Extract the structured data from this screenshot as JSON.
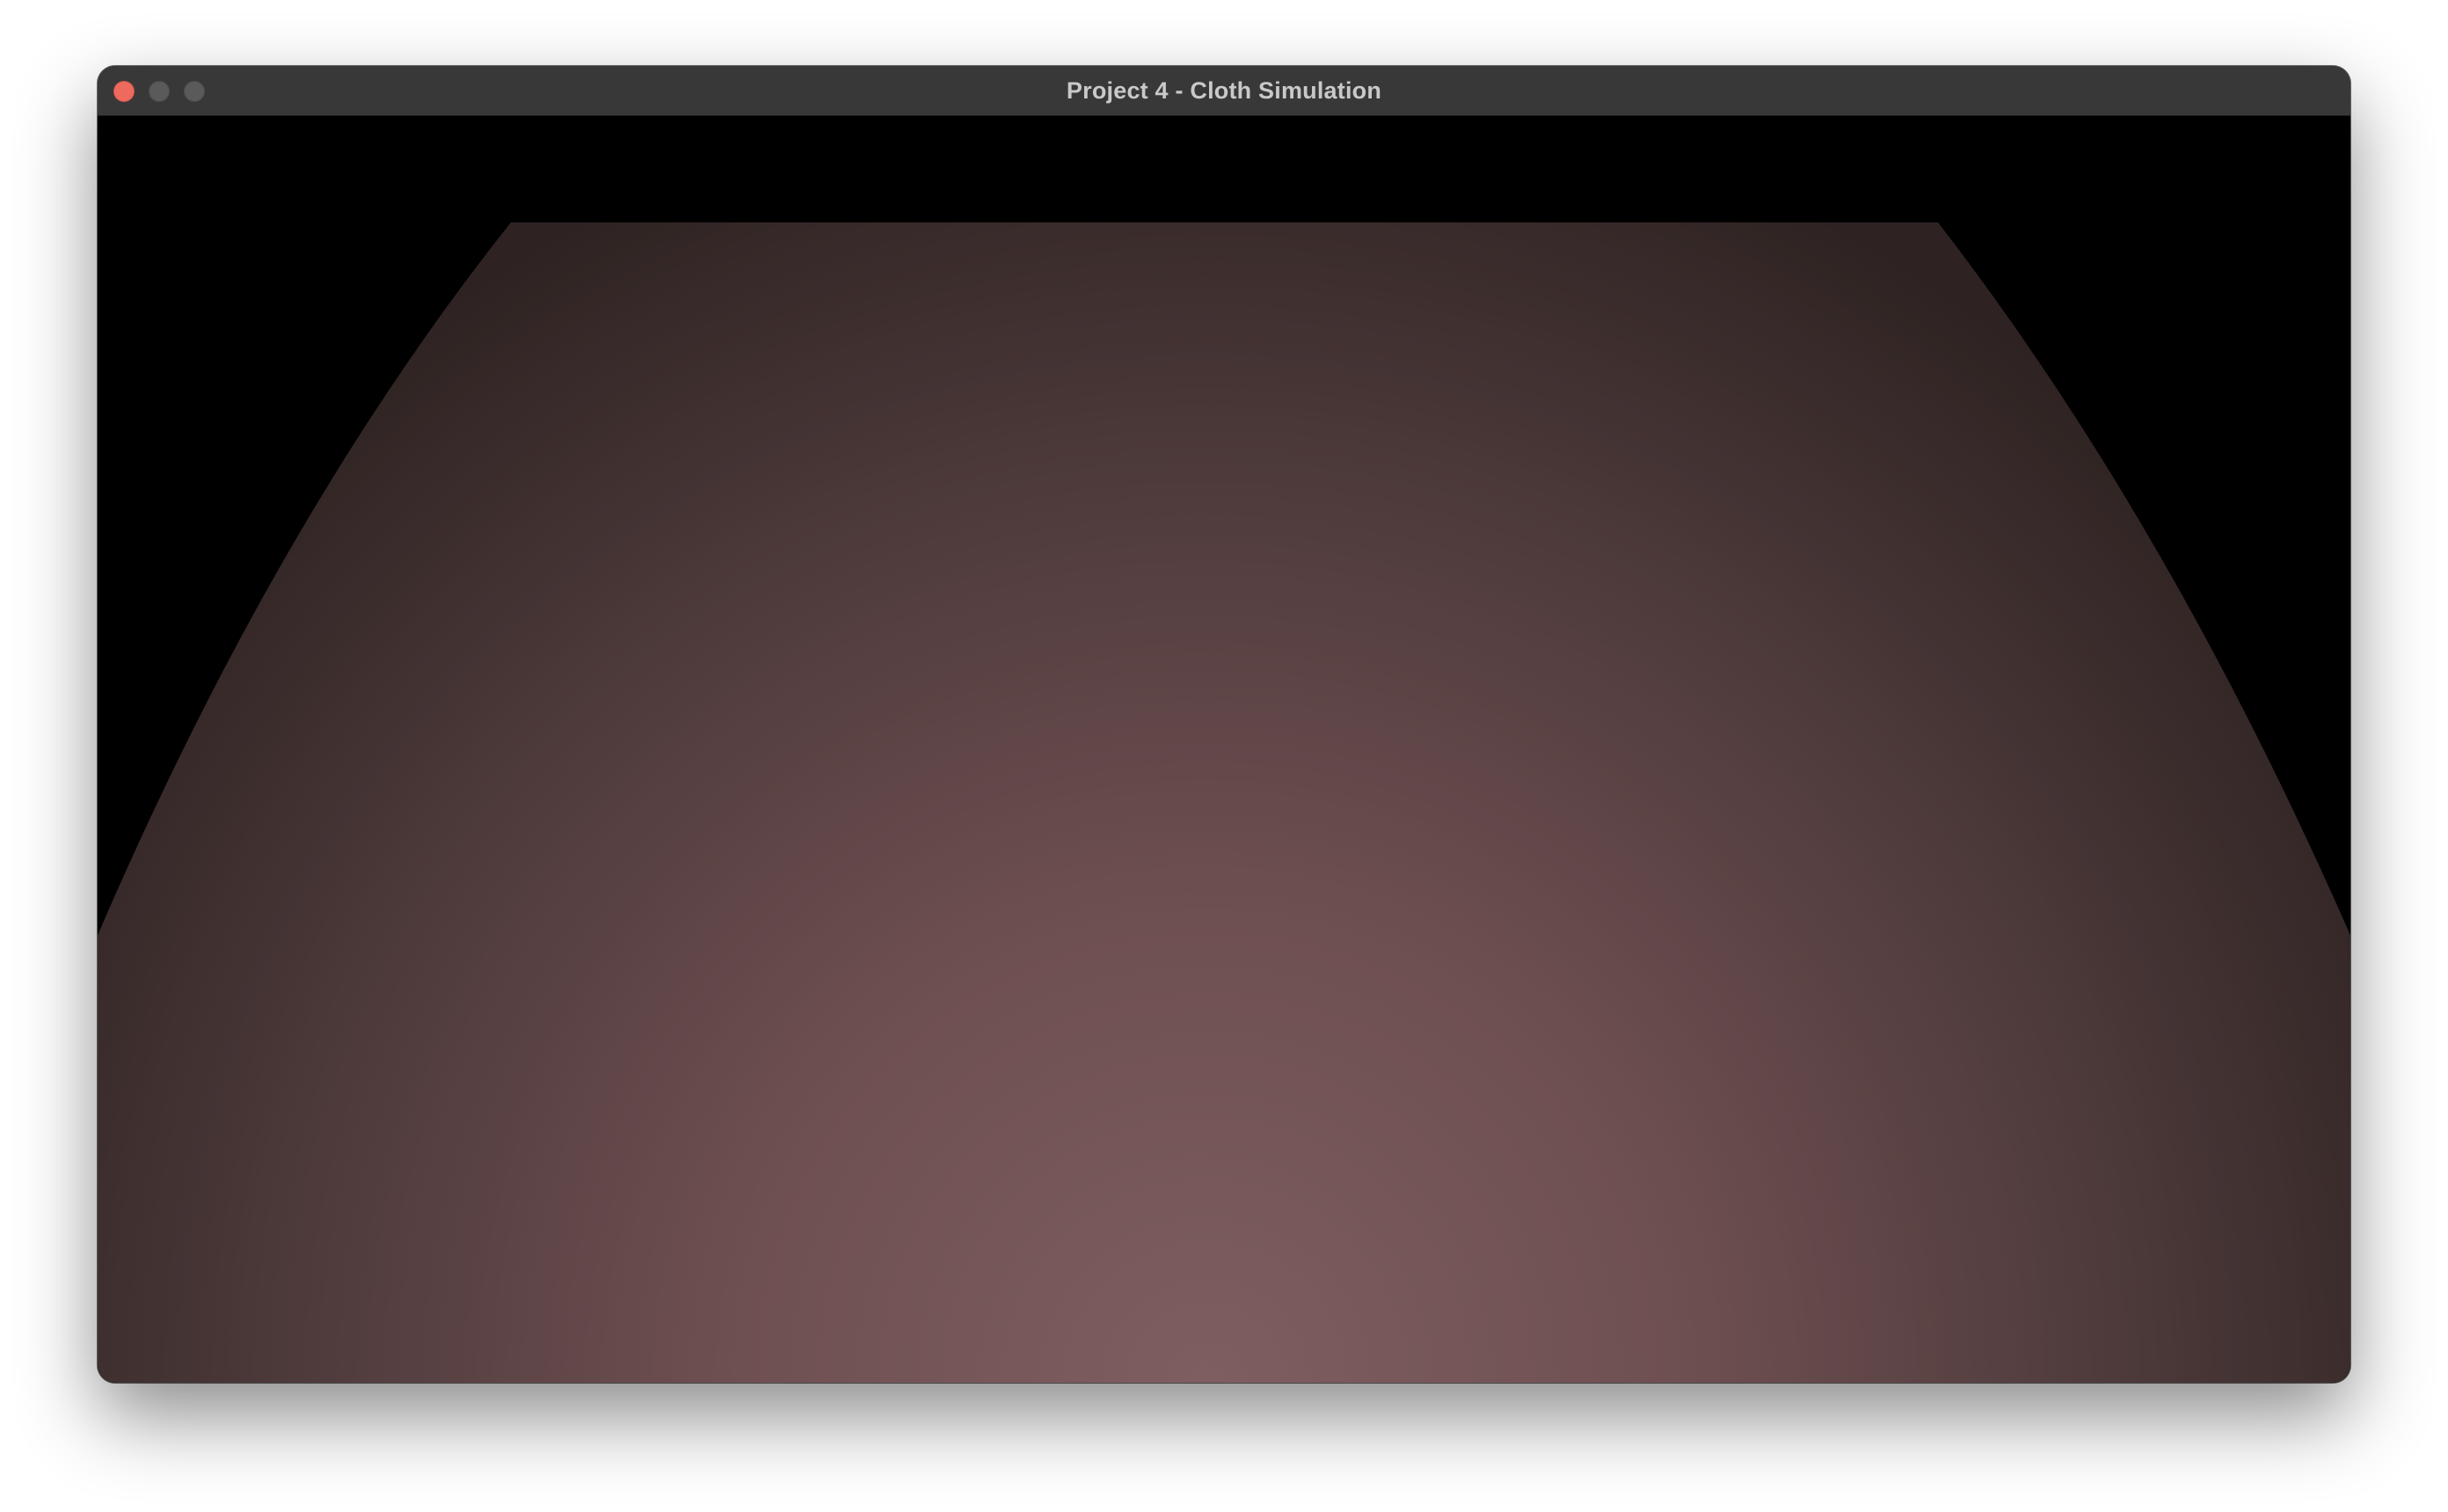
{
  "window": {
    "title": "Project 4 - Cloth Simulation",
    "buttons": {
      "close": "close-button",
      "minimize": "minimize-button",
      "zoom": "zoom-button"
    }
  },
  "scene": {
    "background_color": "#000000",
    "cloth_color_center": "#7e5e60",
    "cloth_color_edge": "#2e2322"
  },
  "colors": {
    "titlebar": "#383838",
    "title_text": "#c9c9c9",
    "close": "#ee6a5f",
    "inactive_button": "#5a5a5a"
  }
}
